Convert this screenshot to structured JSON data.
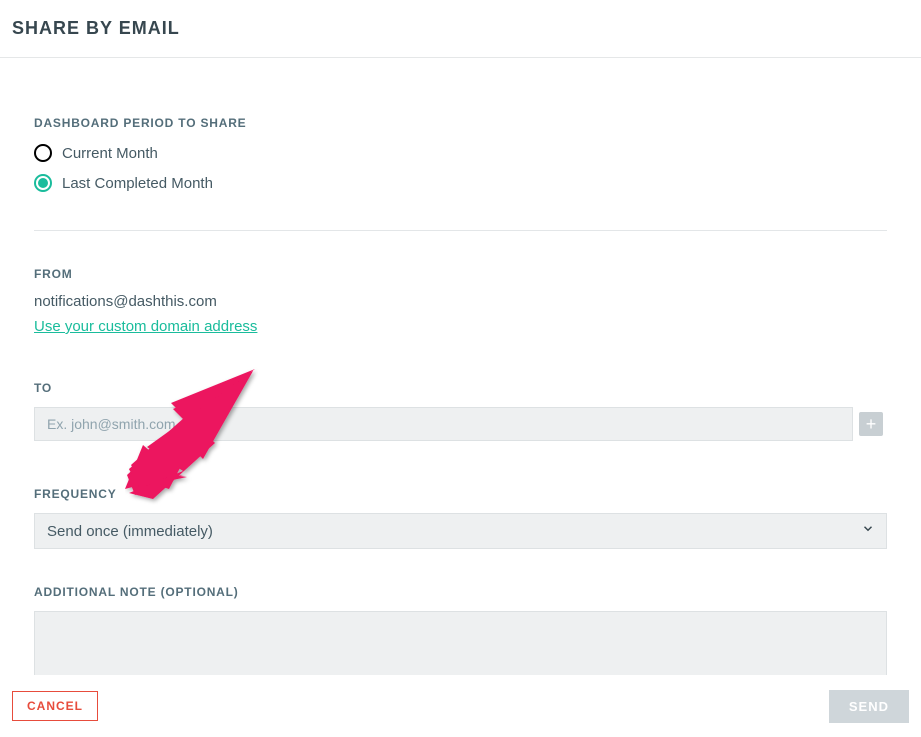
{
  "header": {
    "title": "SHARE BY EMAIL"
  },
  "period": {
    "label": "DASHBOARD PERIOD TO SHARE",
    "options": [
      {
        "label": "Current Month",
        "selected": false
      },
      {
        "label": "Last Completed Month",
        "selected": true
      }
    ]
  },
  "from": {
    "label": "FROM",
    "email": "notifications@dashthis.com",
    "link_text": "Use your custom domain address"
  },
  "to": {
    "label": "TO",
    "placeholder": "Ex. john@smith.com",
    "add_icon": "plus-icon"
  },
  "frequency": {
    "label": "FREQUENCY",
    "selected": "Send once (immediately)"
  },
  "note": {
    "label": "ADDITIONAL NOTE (OPTIONAL)"
  },
  "footer": {
    "cancel_label": "CANCEL",
    "send_label": "SEND"
  },
  "annotation": {
    "arrow_color": "#ec135f"
  }
}
